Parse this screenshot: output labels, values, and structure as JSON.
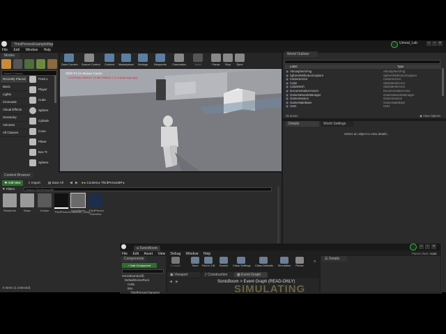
{
  "editor": {
    "tab_title": "ThirdPersonExampleMap",
    "project_badge": "Unreal_Lab",
    "menu": [
      "File",
      "Edit",
      "Window",
      "Help"
    ],
    "modes_tab": "Modes",
    "search_placeholder": "Search Classes",
    "categories": [
      "Recently Placed",
      "Basic",
      "Lights",
      "Cinematic",
      "Visual Effects",
      "Geometry",
      "Volumes",
      "All Classes"
    ],
    "place_items": [
      "Point L",
      "Player",
      "Cube",
      "Sphere",
      "Cylinde",
      "Cone",
      "Plane",
      "Box Tr",
      "Sphere"
    ],
    "toolbar": [
      "Save Current",
      "Source Control",
      "Content",
      "Marketplace",
      "Settings",
      "Blueprints",
      "Cinematics",
      "Build",
      "Pause",
      "Stop",
      "Eject"
    ],
    "viewport": {
      "hint": "Shift+F1 for Mouse Cursor",
      "error": "LIGHTING NEEDS TO BE REBUILT (1 unbuilt object(s))"
    },
    "outliner": {
      "tab": "World Outliner",
      "col_label": "Label",
      "col_type": "Type",
      "rows": [
        {
          "label": "AtmosphericFog",
          "type": "AtmosphericFog"
        },
        {
          "label": "SphereReflectionCapture",
          "type": "SphereReflectionCapture"
        },
        {
          "label": "CameraActor",
          "type": "CameraActor"
        },
        {
          "label": "Cube",
          "type": "StaticMeshActor"
        },
        {
          "label": "CubeMesh",
          "type": "StaticMeshActor"
        },
        {
          "label": "DocumentationActor1",
          "type": "DocumentationActor"
        },
        {
          "label": "GameNetworkManager",
          "type": "GameNetworkManager"
        },
        {
          "label": "GameSession",
          "type": "GameSession"
        },
        {
          "label": "GameStateBase",
          "type": "GameStateBase"
        },
        {
          "label": "HUD",
          "type": "HUD"
        }
      ],
      "count": "35 actors",
      "view_options": "View Options"
    },
    "details": {
      "tab1": "Details",
      "tab2": "World Settings",
      "empty": "Select an object to view details."
    },
    "content_browser": {
      "tab": "Content Browser",
      "add_new": "Add New",
      "import": "Import",
      "save_all": "Save All",
      "path": [
        "Content",
        "ThirdPersonBP"
      ],
      "filters": "Filters",
      "search_placeholder": "Search ThirdPersonBP",
      "items": [
        "Blueprints",
        "Maps",
        "Jumper",
        "ThirdPersonCharacter_Jump...",
        "SonicBoom",
        "ThirdPerson Overview"
      ],
      "status": "6 items (1 selected)"
    }
  },
  "bp_editor": {
    "tab": "SonicBoom",
    "parent_label": "Parent class:",
    "parent_value": "Actor",
    "menu": [
      "File",
      "Edit",
      "Asset",
      "View",
      "Debug",
      "Window",
      "Help"
    ],
    "toolbar": [
      "Compile",
      "Save",
      "Find in CB",
      "Search",
      "Class Settings",
      "Class Defaults",
      "Simulation",
      "Pause"
    ],
    "components_tab": "Components",
    "add_component": "+ Add Component",
    "components": [
      "SonicBoom(self)",
      "DefaultSceneRoot",
      "Cube",
      "Box",
      "ThirdPersonCharacter"
    ],
    "viewport_tab": "Viewport",
    "construction_tab": "Construction Script",
    "event_graph_tab": "Event Graph",
    "graph_title": "SonicBoom > Event Graph",
    "graph_readonly": "(READ-ONLY)",
    "watermark": "SIMULATING",
    "details_tab": "Details"
  }
}
